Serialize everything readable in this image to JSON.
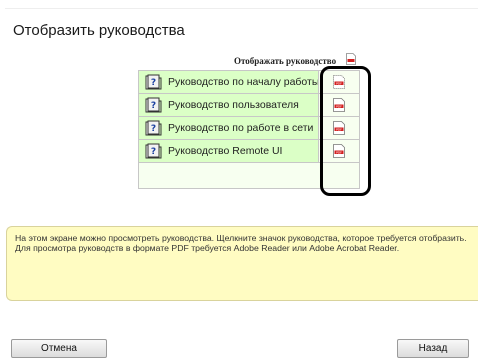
{
  "page": {
    "title": "Отобразить руководства",
    "display_column_label": "Отображать руководство"
  },
  "manuals": [
    {
      "label": "Руководство по началу работы",
      "icon": "help-book-icon",
      "pdf_icon": "pdf-icon"
    },
    {
      "label": "Руководство пользователя",
      "icon": "help-book-icon",
      "pdf_icon": "pdf-icon"
    },
    {
      "label": "Руководство по работе в сети",
      "icon": "help-book-icon",
      "pdf_icon": "pdf-icon"
    },
    {
      "label": "Руководство Remote UI",
      "icon": "help-book-icon",
      "pdf_icon": "pdf-icon"
    }
  ],
  "help": {
    "text": "На этом экране можно просмотреть руководства. Щелкните значок руководства, которое требуется отобразить. Для просмотра руководств в формате PDF требуется Adobe Reader или Adobe Acrobat Reader."
  },
  "buttons": {
    "cancel": "Отмена",
    "back": "Назад"
  },
  "colors": {
    "table_cell": "#dbffc6",
    "table_bg": "#f7fff0",
    "help_bg": "#fffcc2",
    "pdf_red": "#d32020"
  }
}
